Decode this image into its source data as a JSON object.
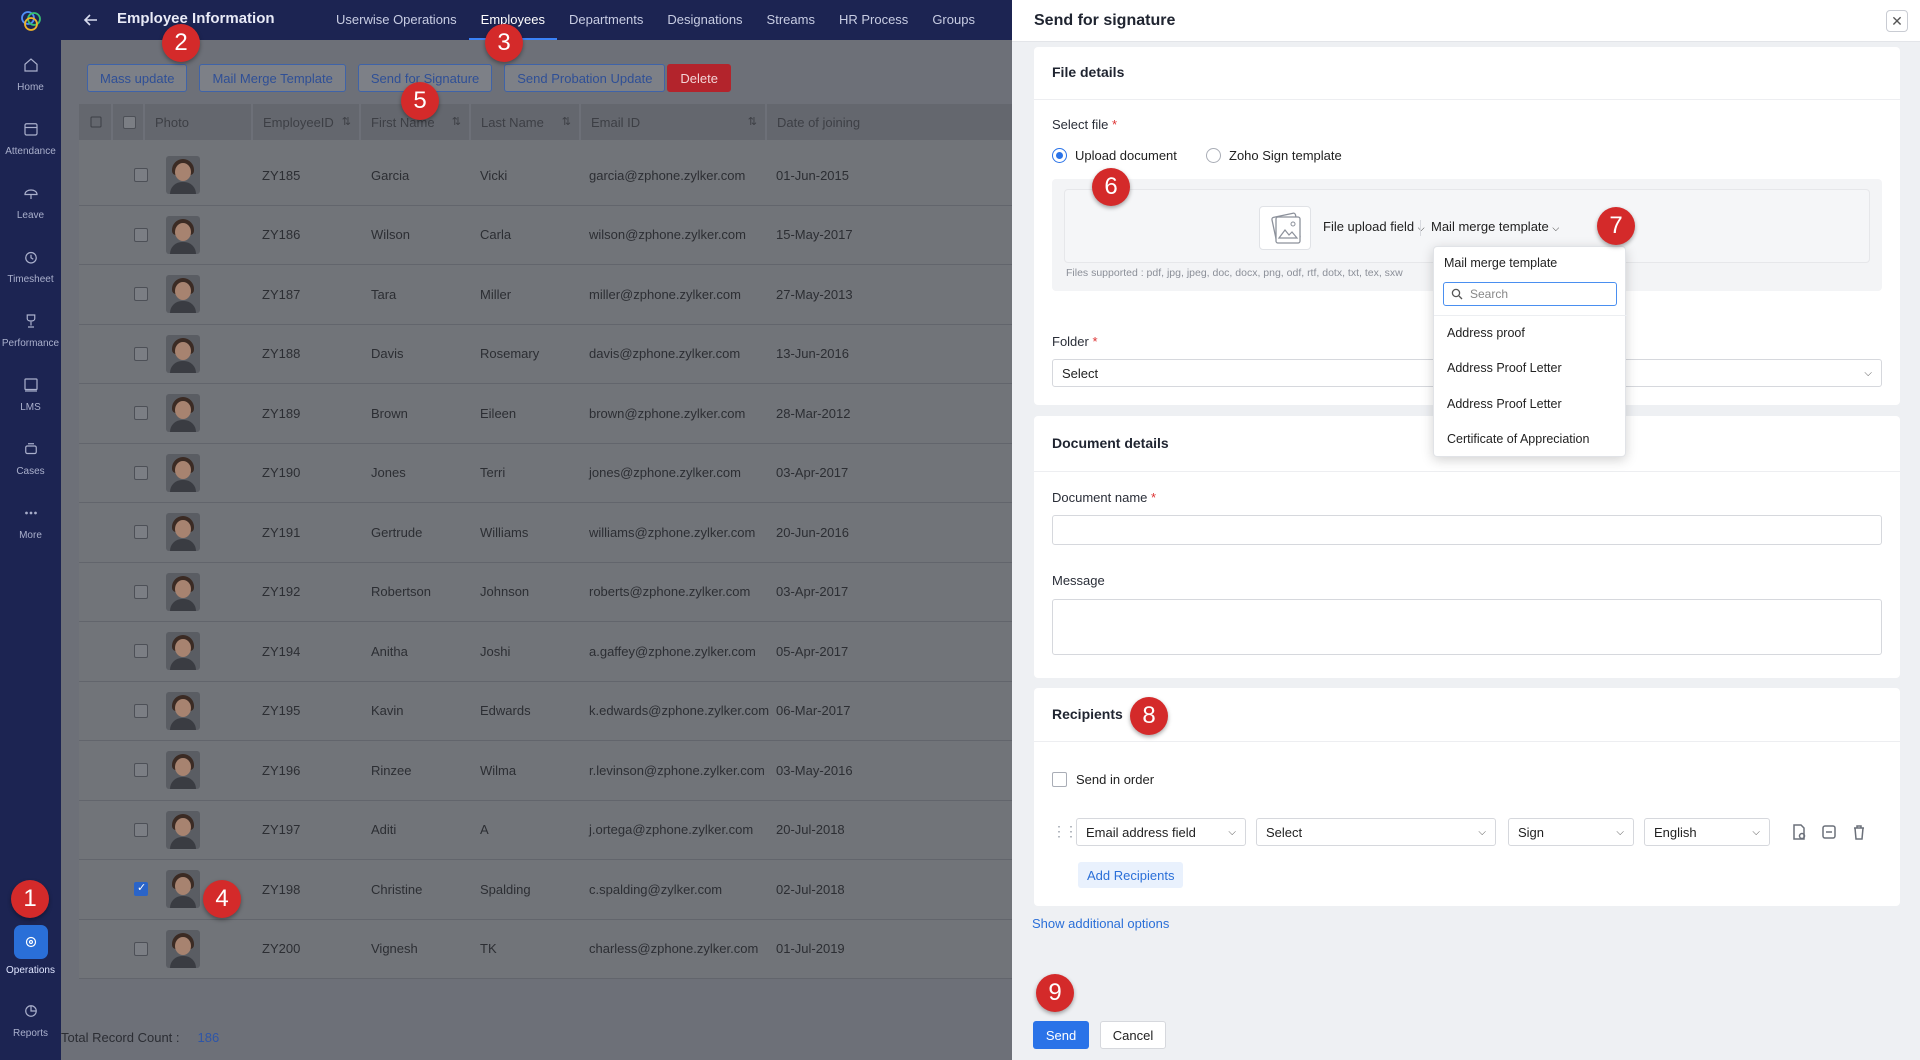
{
  "leftnav": {
    "items": [
      {
        "label": "Home",
        "icon": "home-icon"
      },
      {
        "label": "Attendance",
        "icon": "attendance-icon"
      },
      {
        "label": "Leave",
        "icon": "leave-icon"
      },
      {
        "label": "Timesheet",
        "icon": "timesheet-icon"
      },
      {
        "label": "Performance",
        "icon": "trophy-icon"
      },
      {
        "label": "LMS",
        "icon": "lms-icon"
      },
      {
        "label": "Cases",
        "icon": "cases-icon"
      },
      {
        "label": "More",
        "icon": "more-icon"
      },
      {
        "label": "Operations",
        "icon": "operations-icon",
        "active": true
      },
      {
        "label": "Reports",
        "icon": "reports-icon"
      }
    ]
  },
  "topbar": {
    "title": "Employee Information",
    "tabs": [
      "Userwise Operations",
      "Employees",
      "Departments",
      "Designations",
      "Streams",
      "HR Process",
      "Groups"
    ],
    "active_tab": "Employees"
  },
  "toolbar": {
    "mass_update": "Mass update",
    "mail_merge": "Mail Merge Template",
    "send_signature": "Send for Signature",
    "send_probation": "Send Probation Update",
    "delete": "Delete"
  },
  "table": {
    "columns": {
      "photo": "Photo",
      "employee_id": "EmployeeID",
      "first_name": "First Name",
      "last_name": "Last Name",
      "email": "Email ID",
      "date_of_joining": "Date of joining"
    },
    "rows": [
      {
        "id": "ZY185",
        "first": "Garcia",
        "last": "Vicki",
        "email": "garcia@zphone.zylker.com",
        "doj": "01-Jun-2015",
        "checked": false
      },
      {
        "id": "ZY186",
        "first": "Wilson",
        "last": "Carla",
        "email": "wilson@zphone.zylker.com",
        "doj": "15-May-2017",
        "checked": false
      },
      {
        "id": "ZY187",
        "first": "Tara",
        "last": "Miller",
        "email": "miller@zphone.zylker.com",
        "doj": "27-May-2013",
        "checked": false
      },
      {
        "id": "ZY188",
        "first": "Davis",
        "last": "Rosemary",
        "email": "davis@zphone.zylker.com",
        "doj": "13-Jun-2016",
        "checked": false
      },
      {
        "id": "ZY189",
        "first": "Brown",
        "last": "Eileen",
        "email": "brown@zphone.zylker.com",
        "doj": "28-Mar-2012",
        "checked": false
      },
      {
        "id": "ZY190",
        "first": "Jones",
        "last": "Terri",
        "email": "jones@zphone.zylker.com",
        "doj": "03-Apr-2017",
        "checked": false
      },
      {
        "id": "ZY191",
        "first": "Gertrude",
        "last": "Williams",
        "email": "williams@zphone.zylker.com",
        "doj": "20-Jun-2016",
        "checked": false
      },
      {
        "id": "ZY192",
        "first": "Robertson",
        "last": "Johnson",
        "email": "roberts@zphone.zylker.com",
        "doj": "03-Apr-2017",
        "checked": false
      },
      {
        "id": "ZY194",
        "first": "Anitha",
        "last": "Joshi",
        "email": "a.gaffey@zphone.zylker.com",
        "doj": "05-Apr-2017",
        "checked": false
      },
      {
        "id": "ZY195",
        "first": "Kavin",
        "last": "Edwards",
        "email": "k.edwards@zphone.zylker.com",
        "doj": "06-Mar-2017",
        "checked": false
      },
      {
        "id": "ZY196",
        "first": "Rinzee",
        "last": "Wilma",
        "email": "r.levinson@zphone.zylker.com",
        "doj": "03-May-2016",
        "checked": false
      },
      {
        "id": "ZY197",
        "first": "Aditi",
        "last": "A",
        "email": "j.ortega@zphone.zylker.com",
        "doj": "20-Jul-2018",
        "checked": false
      },
      {
        "id": "ZY198",
        "first": "Christine",
        "last": "Spalding",
        "email": "c.spalding@zylker.com",
        "doj": "02-Jul-2018",
        "checked": true
      },
      {
        "id": "ZY200",
        "first": "Vignesh",
        "last": "TK",
        "email": "charless@zphone.zylker.com",
        "doj": "01-Jul-2019",
        "checked": false
      }
    ],
    "footer_label": "Total Record Count :",
    "footer_count": "186"
  },
  "badges": [
    "1",
    "2",
    "3",
    "4",
    "5",
    "6",
    "7",
    "8",
    "9"
  ],
  "drawer": {
    "title": "Send for signature",
    "file_details": {
      "title": "File details",
      "select_file_label": "Select file",
      "radio_upload": "Upload document",
      "radio_zoho": "Zoho Sign template",
      "file_upload_field": "File upload field",
      "mail_merge_template": "Mail merge template",
      "files_supported": "Files supported : pdf, jpg, jpeg, doc, docx, png, odf, rtf, dotx, txt, tex, sxw",
      "folder_label": "Folder",
      "folder_value": "Select"
    },
    "document_details": {
      "title": "Document details",
      "name_label": "Document name",
      "message_label": "Message"
    },
    "recipients": {
      "title": "Recipients",
      "send_in_order": "Send in order",
      "email_field": "Email address field",
      "select": "Select",
      "action": "Sign",
      "language": "English",
      "add_recipients": "Add Recipients"
    },
    "show_additional": "Show additional options",
    "send": "Send",
    "cancel": "Cancel"
  },
  "dropdown": {
    "title": "Mail merge template",
    "search_placeholder": "Search",
    "items": [
      "Address proof",
      "Address Proof Letter",
      "Address Proof Letter",
      "Certificate of Appreciation"
    ]
  },
  "colors": {
    "nav_bg": "#1c2452",
    "accent": "#2a73e8",
    "badge": "#d42a2a",
    "danger": "#b3242c"
  }
}
